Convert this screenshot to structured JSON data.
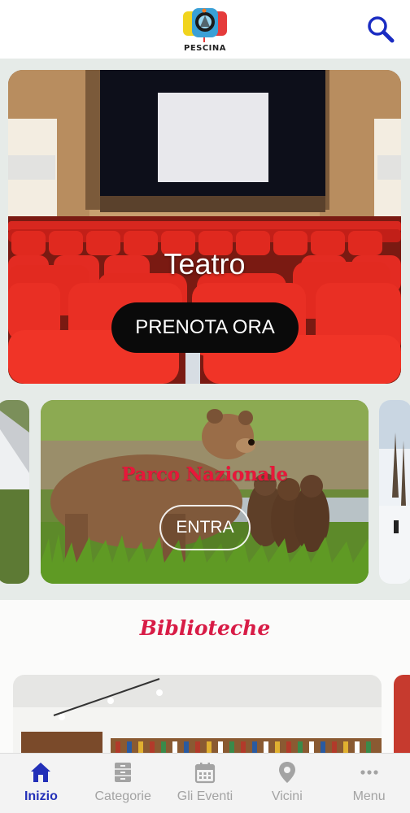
{
  "header": {
    "logo_text": "PESCINA",
    "search_icon": "search-icon"
  },
  "hero": {
    "title": "Teatro",
    "button_label": "PRENOTA ORA"
  },
  "carousel": {
    "card_title": "Parco Nazionale",
    "card_button": "ENTRA"
  },
  "section": {
    "title": "Biblioteche"
  },
  "bottom_nav": {
    "items": [
      {
        "label": "Inizio",
        "icon": "home-icon",
        "active": true
      },
      {
        "label": "Categorie",
        "icon": "drawer-icon",
        "active": false
      },
      {
        "label": "Gli Eventi",
        "icon": "calendar-icon",
        "active": false
      },
      {
        "label": "Vicini",
        "icon": "map-pin-icon",
        "active": false
      },
      {
        "label": "Menu",
        "icon": "more-dots-icon",
        "active": false
      }
    ]
  },
  "colors": {
    "accent": "#2330b8",
    "brand_red": "#d81c46",
    "inactive": "#a3a3a3"
  }
}
